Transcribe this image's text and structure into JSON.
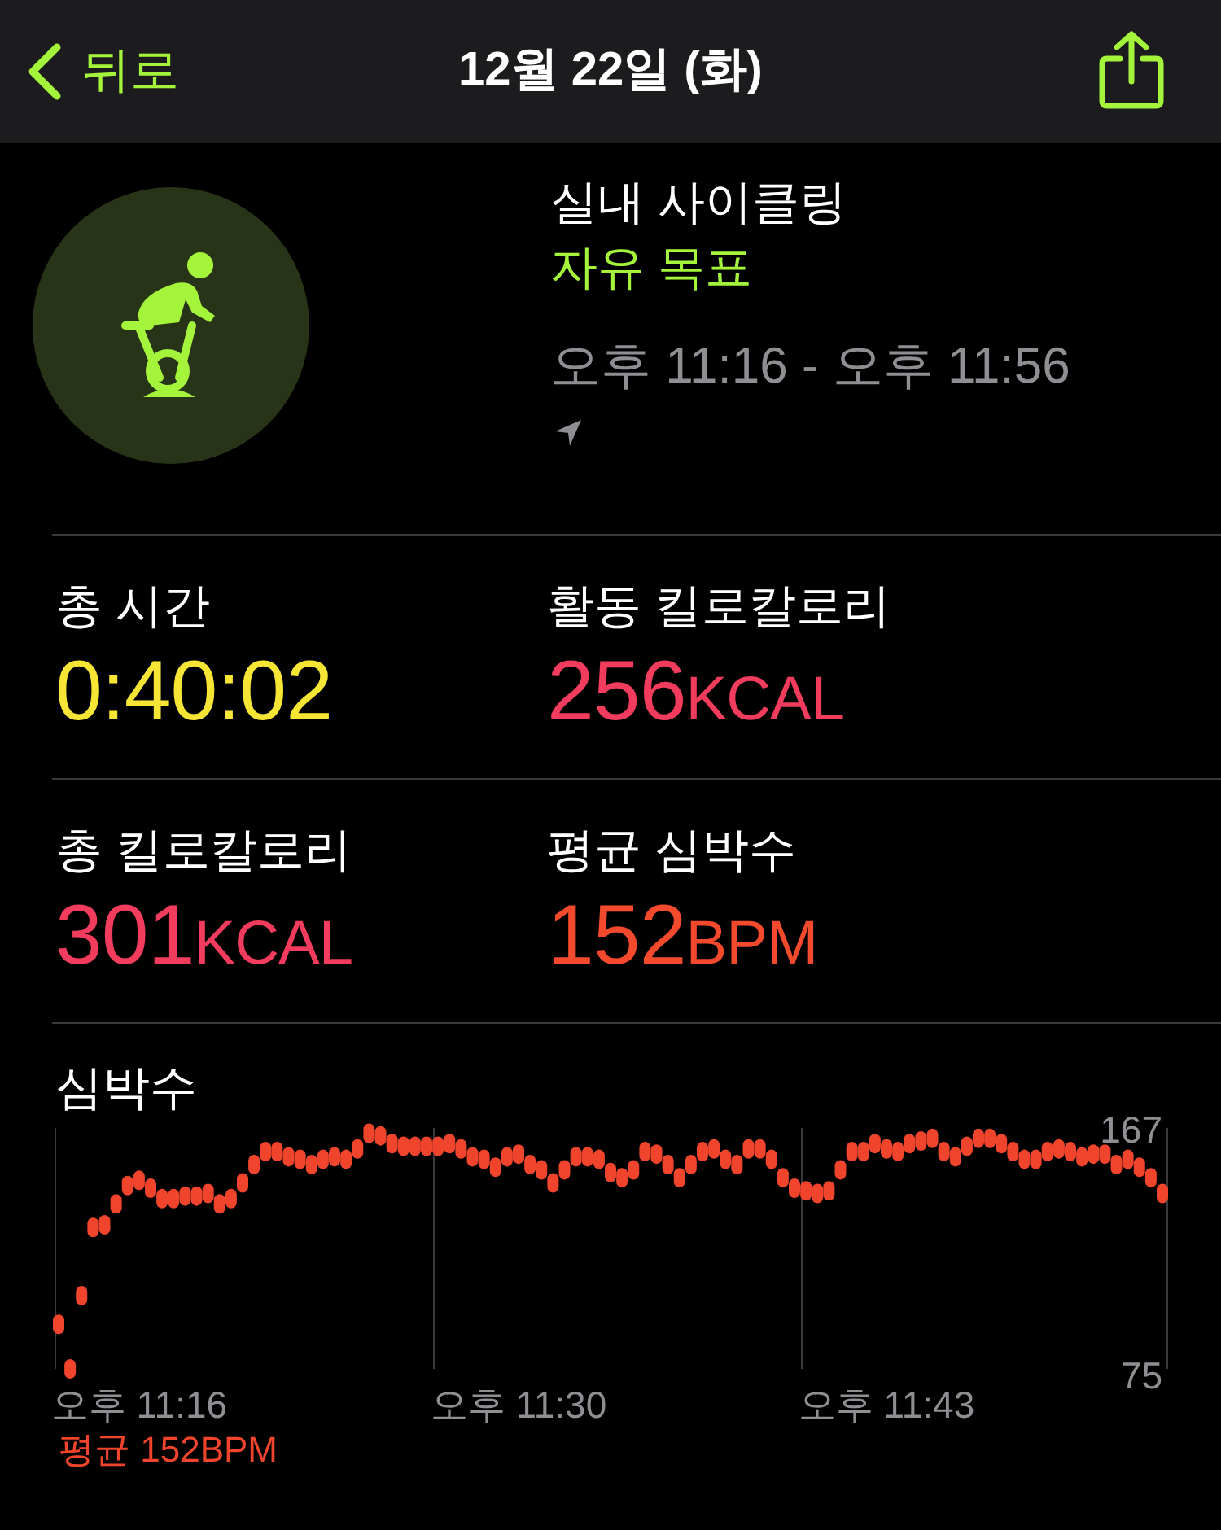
{
  "header": {
    "back_label": "뒤로",
    "title": "12월 22일 (화)"
  },
  "workout": {
    "name": "실내 사이클링",
    "goal": "자유 목표",
    "time_range": "오후 11:16 - 오후 11:56"
  },
  "metrics": [
    {
      "label": "총 시간",
      "value": "0:40:02",
      "color": "#f6e535"
    },
    {
      "label": "활동 킬로칼로리",
      "value": "256",
      "unit": "KCAL",
      "color": "#f23c5d"
    },
    {
      "label": "총 킬로칼로리",
      "value": "301",
      "unit": "KCAL",
      "color": "#f23c5d"
    },
    {
      "label": "평균 심박수",
      "value": "152",
      "unit": "BPM",
      "color": "#f34a2d"
    }
  ],
  "heart_rate": {
    "average": "평균 152BPM",
    "chart_data": {
      "type": "scatter",
      "title": "심박수",
      "categories": [
        null,
        null,
        null,
        null,
        null,
        null,
        null,
        "오후 11:16",
        null,
        null,
        null,
        null,
        null,
        null,
        null,
        null,
        null,
        null,
        null,
        null,
        null,
        null,
        null,
        null,
        null,
        null,
        null,
        null,
        null,
        null,
        null,
        null,
        null,
        null,
        null,
        null,
        null,
        null,
        null,
        null,
        "오후 11:30",
        null,
        null,
        null,
        null,
        null,
        null,
        null,
        null,
        null,
        null,
        null,
        null,
        null,
        null,
        null,
        null,
        null,
        null,
        null,
        null,
        null,
        null,
        null,
        null,
        null,
        null,
        null,
        null,
        null,
        null,
        null,
        "오후 11:43",
        null,
        null,
        null,
        null,
        null,
        null,
        null,
        null,
        null,
        null,
        null,
        null,
        null,
        null,
        null,
        null,
        null,
        null,
        null,
        null,
        null,
        null,
        null,
        null
      ],
      "series": [
        {
          "color": "#f0452c",
          "values": [
            92,
            75,
            103,
            129,
            130,
            138,
            145,
            147,
            144,
            140,
            140,
            141,
            141,
            142,
            138,
            140,
            146,
            153,
            158,
            158,
            156,
            155,
            153,
            155,
            156,
            155,
            159,
            165,
            164,
            161,
            160,
            160,
            160,
            160,
            161,
            159,
            156,
            155,
            152,
            156,
            157,
            153,
            151,
            146,
            151,
            156,
            156,
            155,
            150,
            148,
            151,
            158,
            157,
            153,
            148,
            153,
            158,
            159,
            155,
            153,
            159,
            159,
            155,
            148,
            144,
            143,
            142,
            143,
            151,
            158,
            158,
            161,
            159,
            158,
            161,
            162,
            163,
            158,
            156,
            160,
            163,
            163,
            161,
            158,
            155,
            155,
            158,
            159,
            158,
            156,
            157,
            157,
            153,
            155,
            152,
            148,
            142
          ]
        }
      ],
      "ylim": [
        75,
        167
      ],
      "yticks": [
        75,
        167
      ]
    }
  }
}
